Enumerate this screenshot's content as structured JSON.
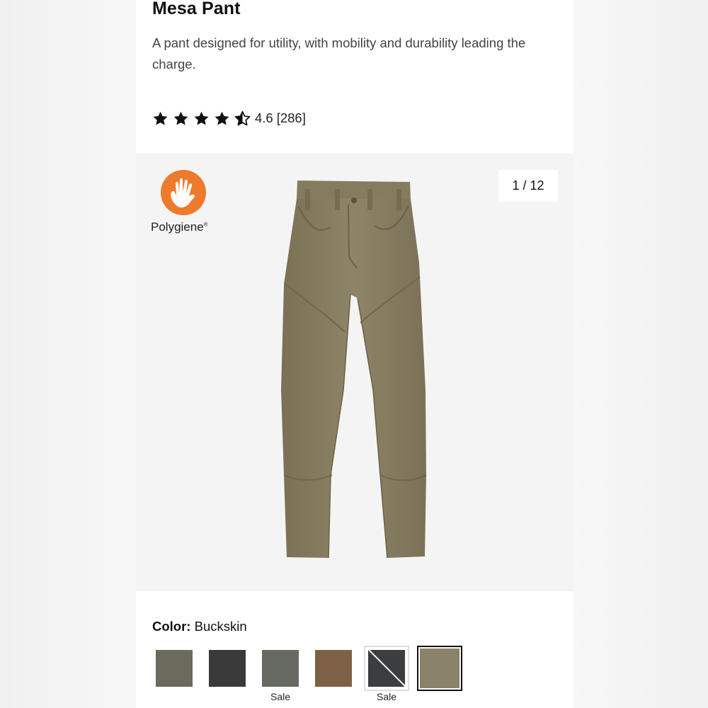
{
  "product": {
    "title": "Mesa Pant",
    "description": "A pant designed for utility, with mobility and durability leading the charge.",
    "rating": {
      "value": "4.6",
      "count": "[286]",
      "stars": 4.5
    }
  },
  "gallery": {
    "badge_text": "Polygiene",
    "counter": "1 / 12",
    "brand_color": "#ee7a2b",
    "product_color": "#8a7f63"
  },
  "color_selector": {
    "label": "Color:",
    "selected": "Buckskin",
    "swatches": [
      {
        "color": "#6b6a5c",
        "tag": ""
      },
      {
        "color": "#3a3a3a",
        "tag": ""
      },
      {
        "color": "#666a62",
        "tag": "Sale"
      },
      {
        "color": "#7d6146",
        "tag": ""
      },
      {
        "color": "#3c3d40",
        "tag": "Sale",
        "sold_out": true
      },
      {
        "color": "#8b826a",
        "tag": "",
        "selected": true
      }
    ]
  }
}
